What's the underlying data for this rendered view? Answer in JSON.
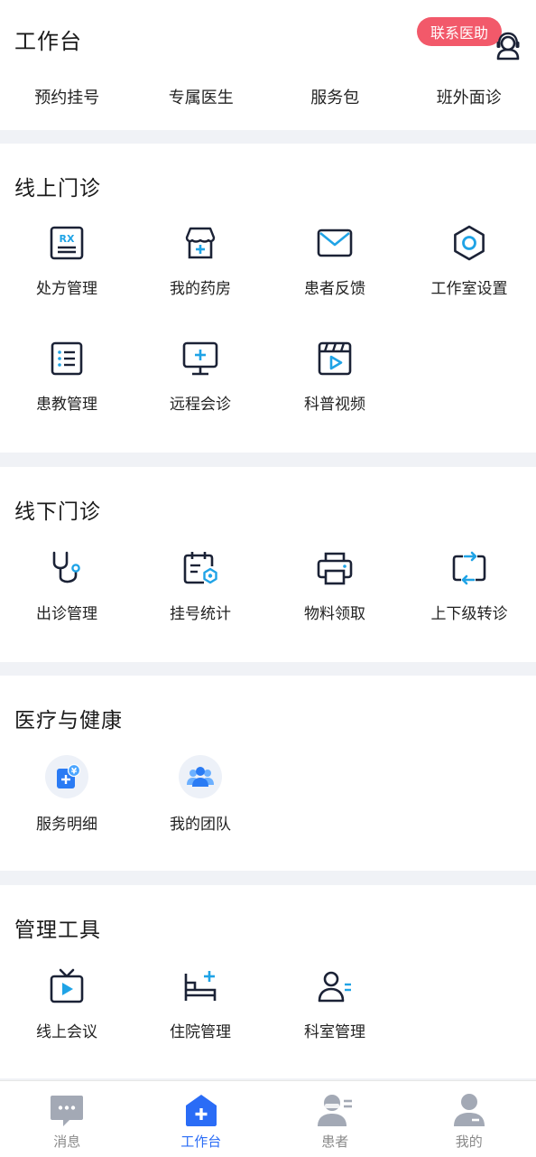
{
  "header": {
    "title": "工作台",
    "contact_label": "联系医助",
    "quick_links": [
      "预约挂号",
      "专属医生",
      "服务包",
      "班外面诊"
    ]
  },
  "online": {
    "title": "线上门诊",
    "items": [
      {
        "label": "处方管理",
        "icon": "prescription-icon",
        "badge": "RX"
      },
      {
        "label": "我的药房",
        "icon": "pharmacy-icon"
      },
      {
        "label": "患者反馈",
        "icon": "mail-icon"
      },
      {
        "label": "工作室设置",
        "icon": "gear-icon"
      },
      {
        "label": "患教管理",
        "icon": "list-icon"
      },
      {
        "label": "远程会诊",
        "icon": "monitor-plus-icon"
      },
      {
        "label": "科普视频",
        "icon": "video-clapper-icon"
      }
    ]
  },
  "offline": {
    "title": "线下门诊",
    "items": [
      {
        "label": "出诊管理",
        "icon": "stethoscope-icon"
      },
      {
        "label": "挂号统计",
        "icon": "calendar-stats-icon"
      },
      {
        "label": "物料领取",
        "icon": "printer-icon"
      },
      {
        "label": "上下级转诊",
        "icon": "transfer-icon"
      }
    ]
  },
  "health": {
    "title": "医疗与健康",
    "items": [
      {
        "label": "服务明细",
        "icon": "service-detail-icon",
        "symbol": "¥"
      },
      {
        "label": "我的团队",
        "icon": "team-icon"
      }
    ]
  },
  "tools": {
    "title": "管理工具",
    "items": [
      {
        "label": "线上会议",
        "icon": "tv-play-icon"
      },
      {
        "label": "住院管理",
        "icon": "hospital-bed-icon"
      },
      {
        "label": "科室管理",
        "icon": "department-user-icon"
      }
    ]
  },
  "tabbar": {
    "items": [
      {
        "label": "消息",
        "icon": "chat-bubble-icon"
      },
      {
        "label": "工作台",
        "icon": "workbench-home-icon",
        "active": true
      },
      {
        "label": "患者",
        "icon": "patient-icon"
      },
      {
        "label": "我的",
        "icon": "profile-icon"
      }
    ]
  },
  "colors": {
    "accent": "#2a6cf6",
    "icon_dark": "#1b2236",
    "icon_blue": "#1fa3e6",
    "contact_bg": "#f2596a"
  }
}
